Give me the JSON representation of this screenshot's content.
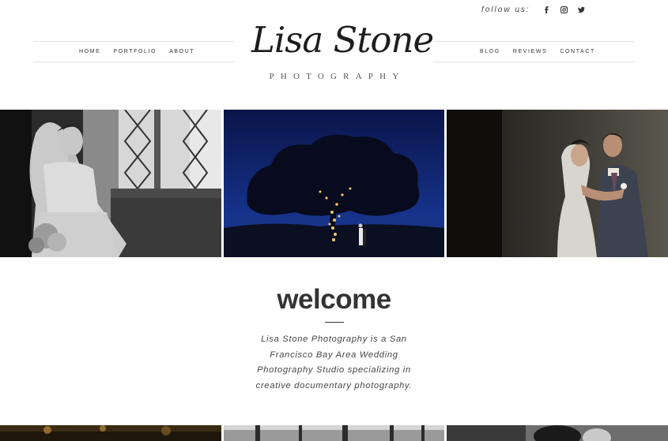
{
  "header": {
    "follow_label": "follow us:",
    "social": [
      {
        "icon": "facebook-icon"
      },
      {
        "icon": "instagram-icon"
      },
      {
        "icon": "twitter-icon"
      }
    ],
    "nav_left": [
      {
        "label": "HOME"
      },
      {
        "label": "PORTFOLIO"
      },
      {
        "label": "ABOUT"
      }
    ],
    "nav_right": [
      {
        "label": "BLOG"
      },
      {
        "label": "REVIEWS"
      },
      {
        "label": "CONTACT"
      }
    ],
    "logo": {
      "script": "Lisa Stone",
      "subtitle": "PHOTOGRAPHY"
    }
  },
  "gallery": {
    "row1": [
      {
        "subject": "black-and-white bride portrait by window"
      },
      {
        "subject": "couple under lit oak tree at night"
      },
      {
        "subject": "couple embracing in dark corridor"
      }
    ],
    "row2": [
      {
        "subject": "warm lit photo"
      },
      {
        "subject": "black-and-white trees photo"
      },
      {
        "subject": "portrait photo"
      }
    ]
  },
  "welcome": {
    "title": "welcome",
    "text": "Lisa Stone Photography is a San Francisco Bay Area Wedding Photography Studio specializing in creative documentary photography."
  },
  "colors": {
    "text": "#333333",
    "rule": "#e2e2e2",
    "background": "#ffffff",
    "night_sky": "#0b1c5e"
  }
}
